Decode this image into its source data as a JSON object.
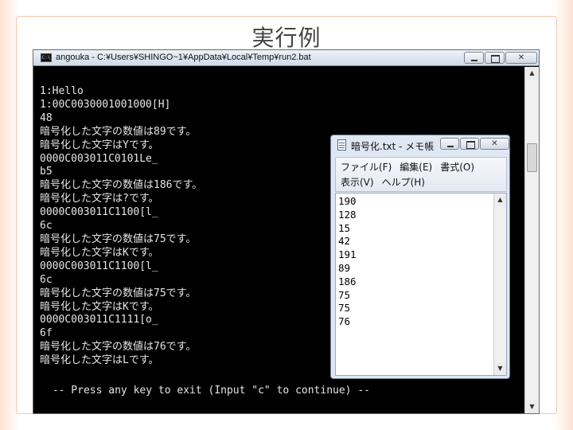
{
  "slide": {
    "title": "実行例"
  },
  "console": {
    "title": "angouka - C:¥Users¥SHINGO~1¥AppData¥Local¥Temp¥run2.bat",
    "icon": "C:\\",
    "lines": [
      "1:Hello",
      "1:00C0030001001000[H]",
      "48",
      "暗号化した文字の数値は89です。",
      "暗号化した文字はYです。",
      "0000C003011C0101Le_",
      "b5",
      "暗号化した文字の数値は186です。",
      "暗号化した文字は?です。",
      "0000C003011C1100[l_",
      "6c",
      "暗号化した文字の数値は75です。",
      "暗号化した文字はKです。",
      "0000C003011C1100[l_",
      "6c",
      "暗号化した文字の数値は75です。",
      "暗号化した文字はKです。",
      "0000C003011C1111[o_",
      "6f",
      "暗号化した文字の数値は76です。",
      "暗号化した文字はLです。"
    ],
    "footer": " -- Press any key to exit (Input \"c\" to continue) --"
  },
  "notepad": {
    "title": "暗号化.txt - メモ帳",
    "menus": {
      "row1": [
        "ファイル(F)",
        "編集(E)",
        "書式(O)"
      ],
      "row2": [
        "表示(V)",
        "ヘルプ(H)"
      ]
    },
    "lines": [
      "190",
      "128",
      "15",
      "42",
      "191",
      "89",
      "186",
      "75",
      "75",
      "76"
    ]
  },
  "icons": {
    "console": "cmd-icon",
    "notepad": "notepad-icon",
    "minimize": "minimize-icon",
    "maximize": "maximize-icon",
    "close": "close-icon"
  },
  "colors": {
    "console_bg": "#000000",
    "console_text": "#e6e6e6",
    "accent": "#fbe2d2"
  }
}
